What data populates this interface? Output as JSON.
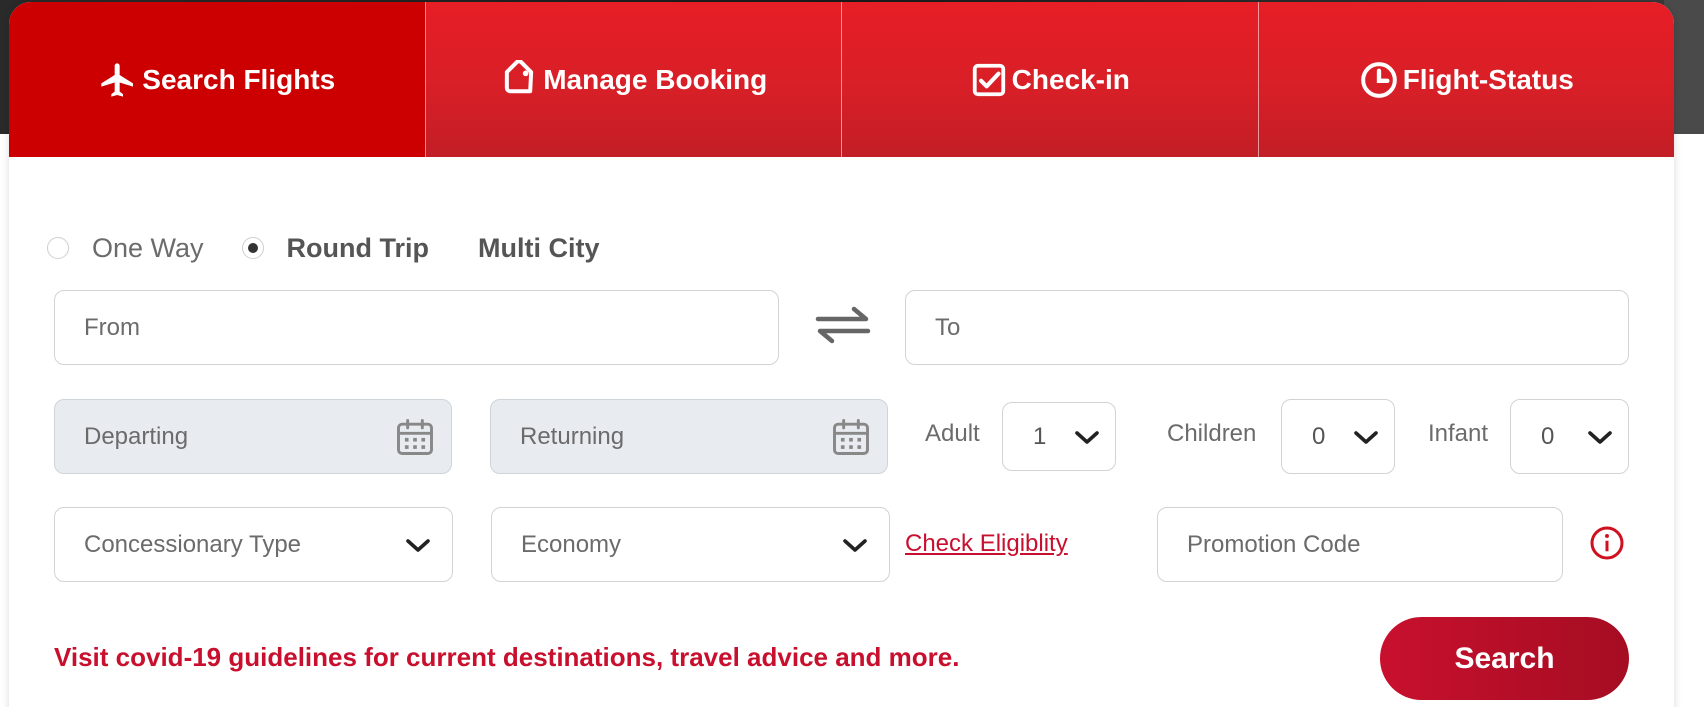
{
  "tabs": [
    {
      "label": "Search Flights",
      "icon": "airplane-icon"
    },
    {
      "label": "Manage Booking",
      "icon": "tag-icon"
    },
    {
      "label": "Check-in",
      "icon": "checkbox-icon"
    },
    {
      "label": "Flight-Status",
      "icon": "clock-icon"
    }
  ],
  "trip_types": {
    "one_way": "One Way",
    "round_trip": "Round Trip",
    "multi_city": "Multi City",
    "selected": "Round Trip"
  },
  "from": {
    "placeholder": "From"
  },
  "to": {
    "placeholder": "To"
  },
  "departing": {
    "placeholder": "Departing"
  },
  "returning": {
    "placeholder": "Returning"
  },
  "passengers": {
    "adult": {
      "label": "Adult",
      "value": "1"
    },
    "children": {
      "label": "Children",
      "value": "0"
    },
    "infant": {
      "label": "Infant",
      "value": "0"
    }
  },
  "concessionary": {
    "value": "Concessionary Type"
  },
  "cabin_class": {
    "value": "Economy"
  },
  "check_eligibility": "Check Eligiblity",
  "promotion": {
    "placeholder": "Promotion Code"
  },
  "covid_notice": "Visit covid-19 guidelines for current destinations, travel advice and more.",
  "search_button": "Search",
  "colors": {
    "brand_red": "#e71e26",
    "accent_red": "#c8102e",
    "active_tab": "#cc0000"
  }
}
